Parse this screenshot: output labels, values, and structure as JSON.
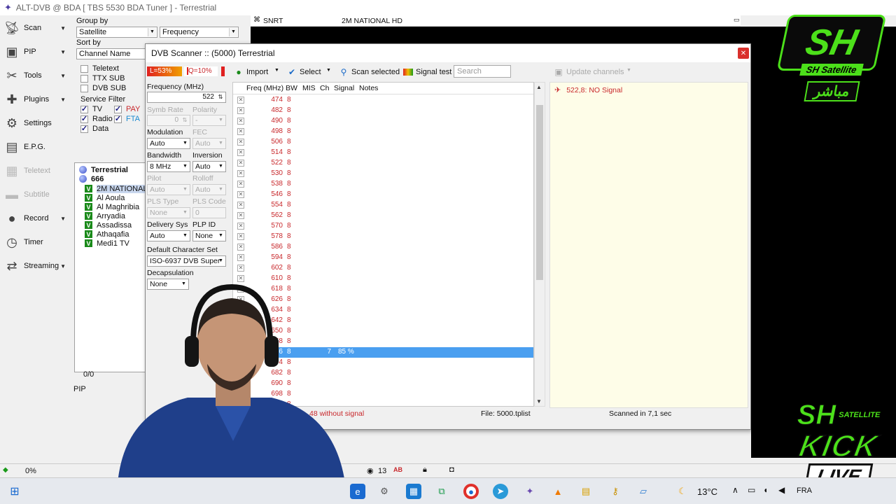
{
  "app": {
    "title": "ALT-DVB @ BDA [ TBS 5530 BDA Tuner ] - Terrestrial"
  },
  "left_menu": [
    {
      "label": "Scan",
      "icon": "satellite-dish-icon",
      "arrow": true,
      "enabled": true
    },
    {
      "label": "PIP",
      "icon": "pip-icon",
      "arrow": true,
      "enabled": true
    },
    {
      "label": "Tools",
      "icon": "tools-icon",
      "arrow": true,
      "enabled": true
    },
    {
      "label": "Plugins",
      "icon": "plugins-icon",
      "arrow": true,
      "enabled": true
    },
    {
      "label": "Settings",
      "icon": "gear-icon",
      "arrow": false,
      "enabled": true
    },
    {
      "label": "E.P.G.",
      "icon": "epg-icon",
      "arrow": false,
      "enabled": true
    },
    {
      "label": "Teletext",
      "icon": "teletext-icon",
      "arrow": false,
      "enabled": false
    },
    {
      "label": "Subtitle",
      "icon": "subtitle-icon",
      "arrow": false,
      "enabled": false
    },
    {
      "label": "Record",
      "icon": "record-icon",
      "arrow": true,
      "enabled": true
    },
    {
      "label": "Timer",
      "icon": "timer-icon",
      "arrow": false,
      "enabled": true
    },
    {
      "label": "Streaming",
      "icon": "streaming-icon",
      "arrow": true,
      "enabled": true
    }
  ],
  "channel_panel": {
    "group_by_label": "Group by",
    "group_by_value": "Satellite",
    "group_by_value2": "Frequency",
    "sort_by_label": "Sort by",
    "sort_by_value": "Channel Name",
    "filters": [
      "Teletext",
      "TTX SUB",
      "DVB SUB"
    ],
    "service_filter_label": "Service Filter",
    "service_filter": {
      "tv": "TV",
      "pay": "PAY",
      "radio": "Radio",
      "fta": "FTA",
      "data": "Data"
    },
    "tree_root": "Terrestrial",
    "tree_freq": "666",
    "channels": [
      "2M NATIONAL HD",
      "Al Aoula",
      "Al Maghribia",
      "Arryadia",
      "Assadissa",
      "Athaqafia",
      "Medi1 TV"
    ],
    "selected_channel_index": 0,
    "counter": "0/0",
    "pip_label": "PIP"
  },
  "video_info": {
    "snrt": "SNRT",
    "channel": "2M NATIONAL HD"
  },
  "scanner": {
    "title": "DVB Scanner :: (5000) Terrestrial",
    "quality_level": "L=53%",
    "quality_q": "Q=10%",
    "frequency_label": "Frequency (MHz)",
    "frequency_value": "522",
    "symb_rate_label": "Symb Rate",
    "symb_rate_value": "0",
    "polarity_label": "Polarity",
    "polarity_value": "-",
    "modulation_label": "Modulation",
    "modulation_value": "Auto",
    "fec_label": "FEC",
    "fec_value": "Auto",
    "bandwidth_label": "Bandwidth",
    "bandwidth_value": "8 MHz",
    "inversion_label": "Inversion",
    "inversion_value": "Auto",
    "pilot_label": "Pilot",
    "pilot_value": "Auto",
    "rolloff_label": "Rolloff",
    "rolloff_value": "Auto",
    "pls_type_label": "PLS Type",
    "pls_type_value": "None",
    "pls_code_label": "PLS Code",
    "pls_code_value": "0",
    "delivery_sys_label": "Delivery Sys",
    "delivery_sys_value": "Auto",
    "plp_id_label": "PLP ID",
    "plp_id_value": "None",
    "charset_label": "Default Character Set",
    "charset_value": "ISO-6937 DVB Super",
    "decap_label": "Decapsulation",
    "decap_value": "None",
    "toolbar": {
      "import": "Import",
      "select": "Select",
      "scan_selected": "Scan selected",
      "signal_test": "Signal test",
      "search_placeholder": "Search",
      "update_channels": "Update channels"
    },
    "columns": [
      "Freq (MHz)",
      "BW",
      "MIS",
      "Ch",
      "Signal",
      "Notes"
    ],
    "rows": [
      {
        "freq": "474",
        "bw": "8"
      },
      {
        "freq": "482",
        "bw": "8"
      },
      {
        "freq": "490",
        "bw": "8"
      },
      {
        "freq": "498",
        "bw": "8"
      },
      {
        "freq": "506",
        "bw": "8"
      },
      {
        "freq": "514",
        "bw": "8"
      },
      {
        "freq": "522",
        "bw": "8"
      },
      {
        "freq": "530",
        "bw": "8"
      },
      {
        "freq": "538",
        "bw": "8"
      },
      {
        "freq": "546",
        "bw": "8"
      },
      {
        "freq": "554",
        "bw": "8"
      },
      {
        "freq": "562",
        "bw": "8"
      },
      {
        "freq": "570",
        "bw": "8"
      },
      {
        "freq": "578",
        "bw": "8"
      },
      {
        "freq": "586",
        "bw": "8"
      },
      {
        "freq": "594",
        "bw": "8"
      },
      {
        "freq": "602",
        "bw": "8"
      },
      {
        "freq": "610",
        "bw": "8"
      },
      {
        "freq": "618",
        "bw": "8"
      },
      {
        "freq": "626",
        "bw": "8"
      },
      {
        "freq": "634",
        "bw": "8"
      },
      {
        "freq": "642",
        "bw": "8"
      },
      {
        "freq": "650",
        "bw": "8"
      },
      {
        "freq": "658",
        "bw": "8"
      },
      {
        "freq": "666",
        "bw": "8",
        "ch": "7",
        "signal": "85 %",
        "selected": true
      },
      {
        "freq": "674",
        "bw": "8"
      },
      {
        "freq": "682",
        "bw": "8"
      },
      {
        "freq": "690",
        "bw": "8"
      },
      {
        "freq": "698",
        "bw": "8"
      },
      {
        "freq": "706",
        "bw": "8"
      }
    ],
    "log": "522,8: NO Signal",
    "status_without_signal": "48 without signal",
    "status_file": "File: 5000.tplist",
    "status_scanned": "Scanned in 7,1 sec"
  },
  "main_status": {
    "progress_text": "0%",
    "count": "13"
  },
  "taskbar": {
    "temperature": "13°C",
    "language": "FRA"
  },
  "overlay": {
    "sh_top": "SH",
    "sh_top_sub": "SH Satellite",
    "live_word": "مباشر",
    "sh_bottom": "SH",
    "sh_bottom_sub": "SATELLITE",
    "kick": "KICK",
    "live": "LIVE"
  },
  "colors": {
    "accent_select": "#4a9ff0",
    "signal_red": "#c8282c",
    "log_bg": "#fefde8",
    "brand_green": "#4ce01a"
  }
}
